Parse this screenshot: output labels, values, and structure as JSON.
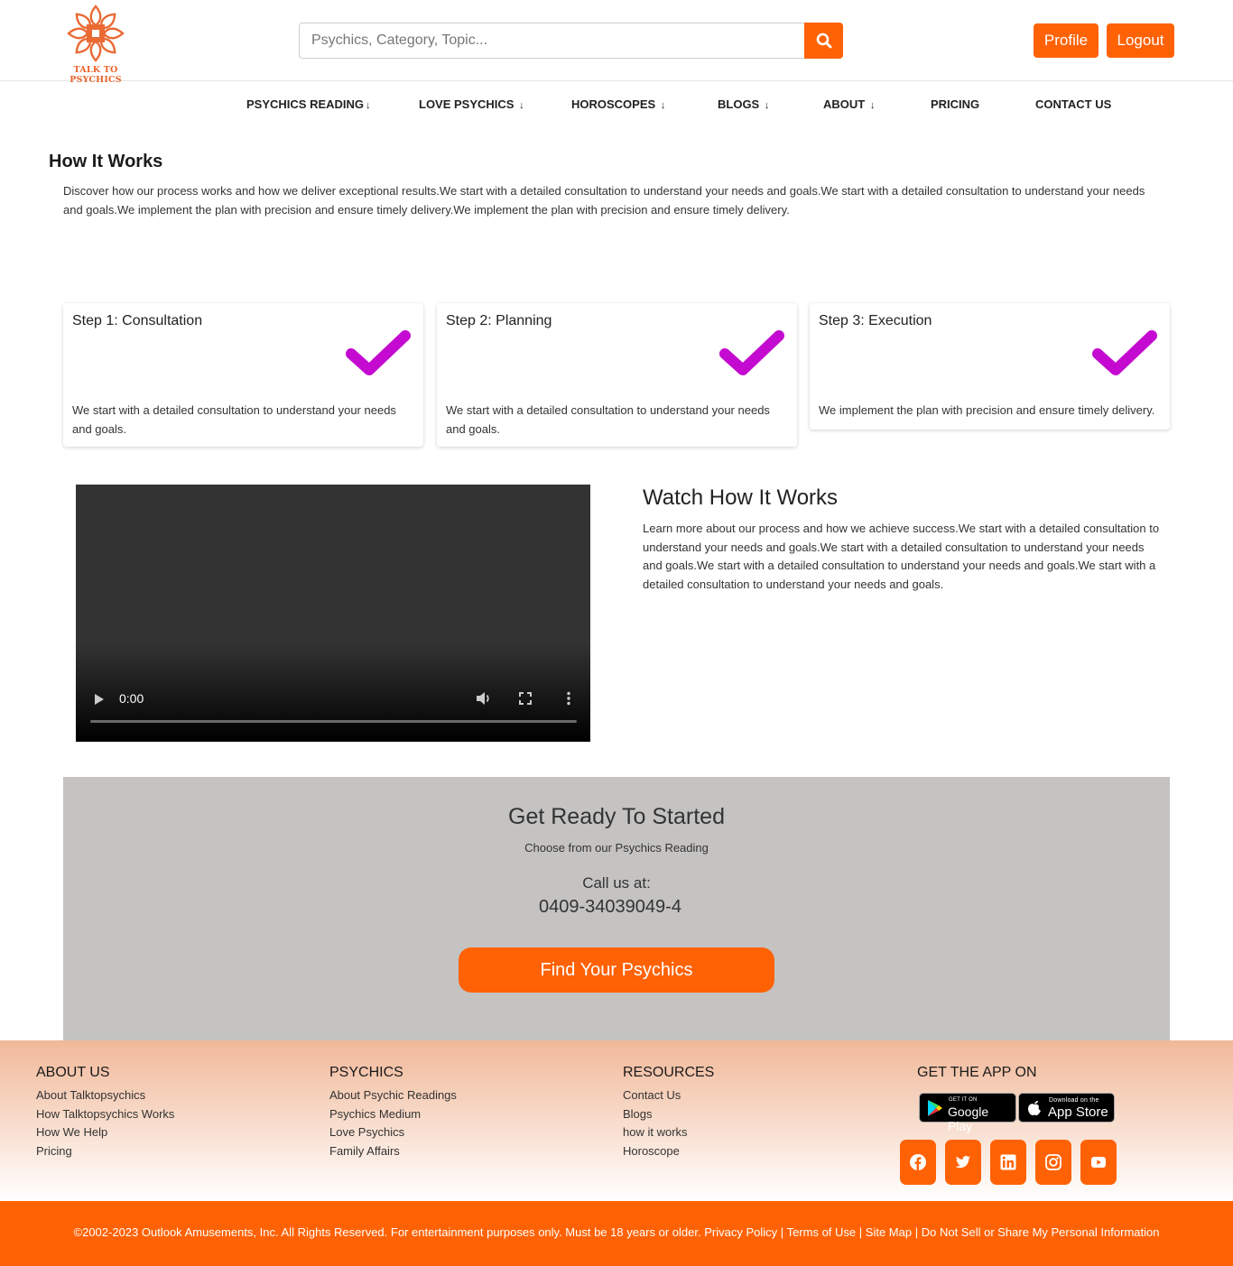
{
  "header": {
    "logo_text": "TALK TO PSYCHICS",
    "search_placeholder": "Psychics, Category, Topic...",
    "search_icon": "search-icon",
    "profile_label": "Profile",
    "logout_label": "Logout"
  },
  "nav": {
    "items": [
      {
        "label": "PSYCHICS READING",
        "arrow": "↓"
      },
      {
        "label": "LOVE PSYCHICS",
        "arrow": "↓"
      },
      {
        "label": "HOROSCOPES",
        "arrow": "↓"
      },
      {
        "label": "BLOGS",
        "arrow": "↓"
      },
      {
        "label": "ABOUT",
        "arrow": "↓"
      },
      {
        "label": "PRICING",
        "arrow": ""
      },
      {
        "label": "CONTACT US",
        "arrow": ""
      }
    ]
  },
  "how_it_works": {
    "title": "How It Works",
    "description": "Discover how our process works and how we deliver exceptional results.We start with a detailed consultation to understand your needs and goals.We start with a detailed consultation to understand your needs and goals.We implement the plan with precision and ensure timely delivery.We implement the plan with precision and ensure timely delivery."
  },
  "steps": [
    {
      "title": "Step 1: Consultation",
      "text": "We start with a detailed consultation to understand your needs and goals.",
      "icon": "checkmark-icon"
    },
    {
      "title": "Step 2: Planning",
      "text": "We start with a detailed consultation to understand your needs and goals.",
      "icon": "checkmark-icon"
    },
    {
      "title": "Step 3: Execution",
      "text": "We implement the plan with precision and ensure timely delivery.",
      "icon": "checkmark-icon"
    }
  ],
  "video": {
    "time": "0:00",
    "progress": 0
  },
  "watch": {
    "title": "Watch How It Works",
    "description": "Learn more about our process and how we achieve success.We start with a detailed consultation to understand your needs and goals.We start with a detailed consultation to understand your needs and goals.We start with a detailed consultation to understand your needs and goals.We start with a detailed consultation to understand your needs and goals."
  },
  "cta": {
    "title": "Get Ready To Started",
    "subtitle": "Choose from our Psychics Reading",
    "call_label": "Call us at:",
    "phone": "0409-34039049-4",
    "button_label": "Find Your Psychics"
  },
  "footer": {
    "columns": [
      {
        "heading": "ABOUT US",
        "links": [
          "About Talktopsychics",
          "How Talktopsychics Works",
          "How We Help",
          "Pricing"
        ]
      },
      {
        "heading": "PSYCHICS",
        "links": [
          "About Psychic Readings",
          "Psychics Medium",
          "Love Psychics",
          "Family Affairs"
        ]
      },
      {
        "heading": "RESOURCES",
        "links": [
          "Contact Us",
          "Blogs",
          "how it works",
          "Horoscope"
        ]
      }
    ],
    "app_heading": "GET THE APP ON",
    "google_play": {
      "small": "GET IT ON",
      "big": "Google Play"
    },
    "app_store": {
      "small": "Download on the",
      "big": "App Store"
    },
    "social_icons": [
      "facebook-icon",
      "twitter-icon",
      "linkedin-icon",
      "instagram-icon",
      "youtube-icon"
    ]
  },
  "bottom": {
    "copyright": "©2002-2023 Outlook Amusements, Inc. All Rights Reserved. For entertainment purposes only. Must be 18 years or older.",
    "privacy": "Privacy Policy",
    "terms": "Terms of Use",
    "sitemap": "Site Map",
    "do_not_sell": "Do Not Sell or Share My Personal Information",
    "separator": "|"
  },
  "colors": {
    "accent": "#ff6205",
    "check": "#c40ad0",
    "cta_bg": "#c4c3c2"
  }
}
